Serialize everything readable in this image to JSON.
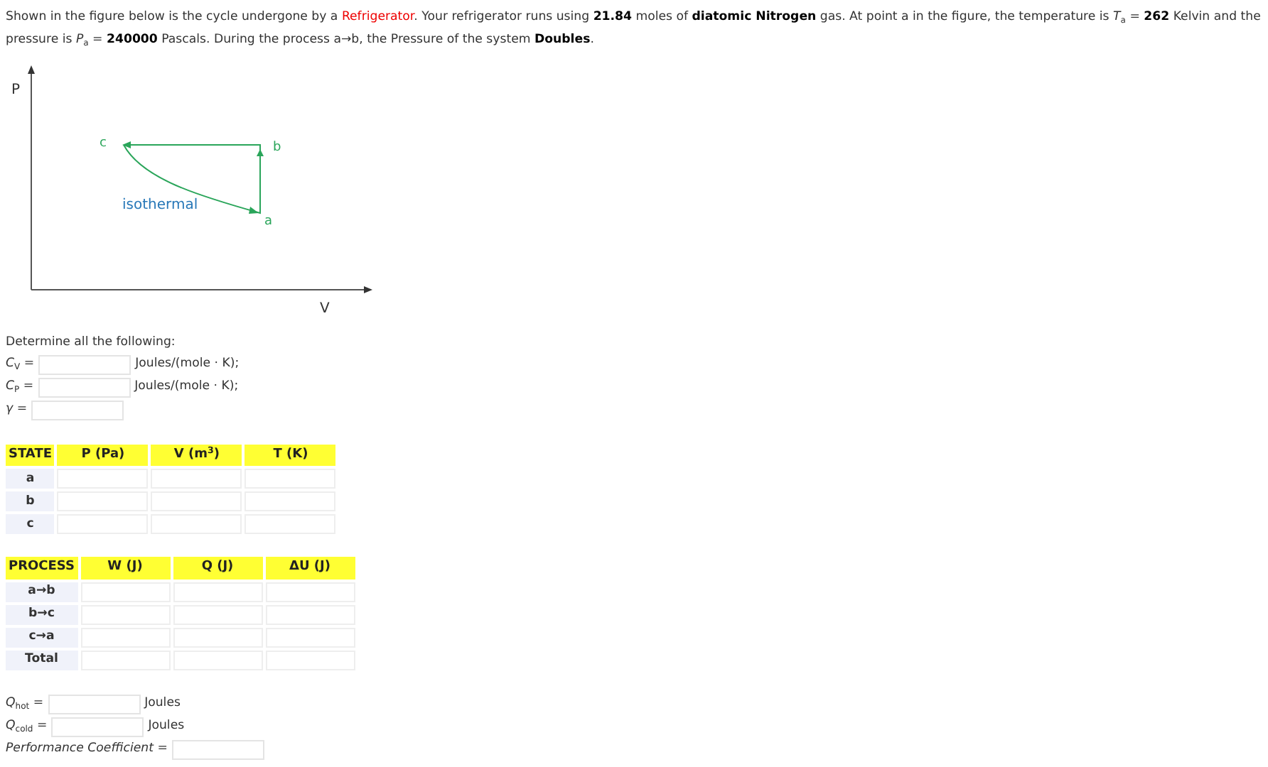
{
  "intro": [
    {
      "kind": "text",
      "text": "Shown in the figure below is the cycle undergone by a "
    },
    {
      "kind": "keyword",
      "text": "Refrigerator"
    },
    {
      "kind": "text",
      "text": ". Your refrigerator runs using **21.84** moles of **diatomic Nitrogen** gas. At point a in the figure, the temperature is *T*$_{a}$ = **262** Kelvin and the pressure is *P*$_{a}$ = **240000** Pascals. During the process a→b, the Pressure of the system **Doubles**."
    }
  ],
  "figure": {
    "y_axis_label": "P",
    "x_axis_label": "V",
    "points": [
      "c",
      "b",
      "a"
    ],
    "curve_label": "isothermal"
  },
  "prompt": "Determine all the following:",
  "constants": [
    {
      "label": "*C*$_{V}$ =",
      "unit": "Joules/(mole · K);"
    },
    {
      "label": "*C*$_{P}$ =",
      "unit": "Joules/(mole · K);"
    },
    {
      "label": "*γ* ="
    }
  ],
  "state_table": {
    "columns": [
      "STATE",
      "P (Pa)",
      "V (m$^{3}$)",
      "T (K)"
    ],
    "rows": [
      "a",
      "b",
      "c"
    ]
  },
  "process_table": {
    "columns": [
      "PROCESS",
      "W (J)",
      "Q (J)",
      "ΔU (J)"
    ],
    "rows": [
      "a→b",
      "b→c",
      "c→a",
      "Total"
    ]
  },
  "results": [
    {
      "label": "*Q*$_{hot}$ =",
      "unit": "Joules"
    },
    {
      "label": "*Q*$_{cold}$ =",
      "unit": "Joules"
    },
    {
      "label": "*Performance Coefficient* ="
    }
  ]
}
